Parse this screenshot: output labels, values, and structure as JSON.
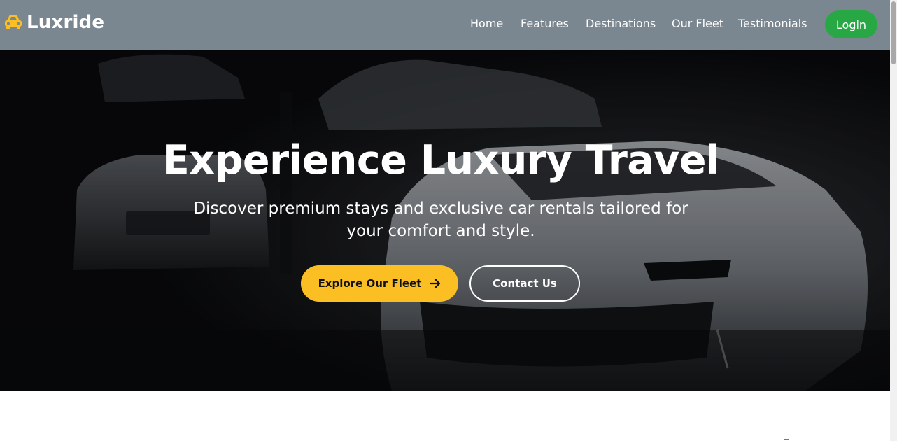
{
  "navbar": {
    "brand": "Luxride",
    "brand_icon": "car-icon",
    "links": [
      "Home",
      "Features",
      "Destinations",
      "Our Fleet",
      "Testimonials"
    ],
    "login_label": "Login"
  },
  "hero": {
    "title": "Experience Luxury Travel",
    "subtitle": "Discover premium stays and exclusive car rentals tailored for your comfort and style.",
    "primary_button": "Explore Our Fleet",
    "primary_button_icon": "arrow-right-icon",
    "secondary_button": "Contact Us"
  },
  "colors": {
    "navbar_bg": "#7b8790",
    "brand_icon": "#fbbf24",
    "login_bg": "#28a745",
    "primary_button_bg": "#fbbf24",
    "hero_bg": "#0b0c0e"
  }
}
